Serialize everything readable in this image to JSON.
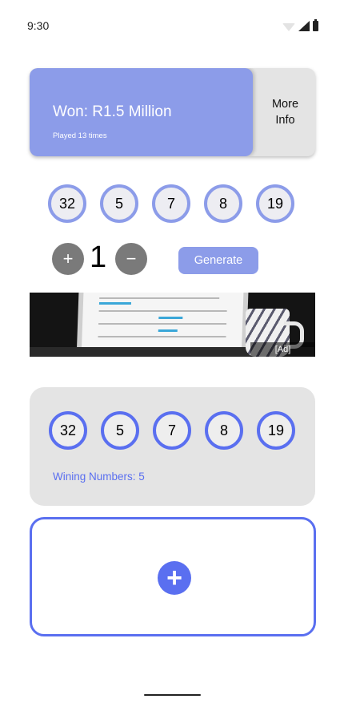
{
  "status": {
    "time": "9:30"
  },
  "top_card": {
    "title": "Won: R1.5 Million",
    "subtitle": "Played 13 times",
    "more_info_line1": "More",
    "more_info_line2": "Info"
  },
  "pick_numbers": [
    "32",
    "5",
    "7",
    "8",
    "19"
  ],
  "controls": {
    "count": "1",
    "plus": "+",
    "minus": "−",
    "generate_label": "Generate"
  },
  "ad": {
    "label": "[Ad]"
  },
  "results": {
    "numbers": [
      "32",
      "5",
      "7",
      "8",
      "19"
    ],
    "winning_text": "Wining Numbers: 5"
  },
  "add_card": {
    "icon": "plus-icon"
  },
  "colors": {
    "accent_light": "#8c9ce9",
    "accent": "#5a6ff0",
    "card_gray": "#e4e4e4"
  }
}
